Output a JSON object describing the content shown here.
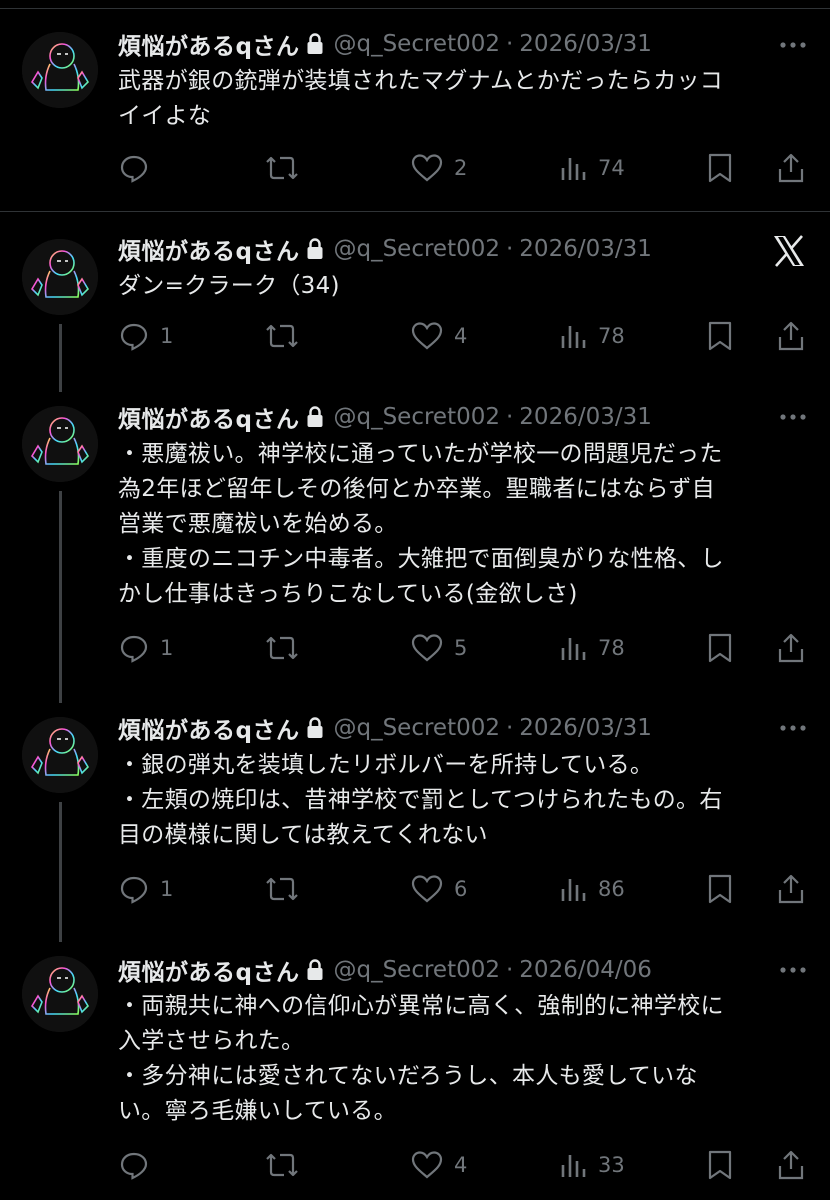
{
  "author": {
    "display_name": "煩悩があるqさん",
    "handle": "@q_Secret002"
  },
  "tweets": [
    {
      "date": "2026/03/31",
      "lines": [
        "武器が銀の銃弾が装填されたマグナムとかだったらカッコ",
        "イイよな"
      ],
      "replies": "",
      "likes": "2",
      "views": "74"
    },
    {
      "date": "2026/03/31",
      "lines": [
        "ダン=クラーク（34)"
      ],
      "replies": "1",
      "likes": "4",
      "views": "78"
    },
    {
      "date": "2026/03/31",
      "lines": [
        "・悪魔祓い。神学校に通っていたが学校一の問題児だった",
        "為2年ほど留年しその後何とか卒業。聖職者にはならず自",
        "営業で悪魔祓いを始める。",
        "・重度のニコチン中毒者。大雑把で面倒臭がりな性格、し",
        "かし仕事はきっちりこなしている(金欲しさ)"
      ],
      "replies": "1",
      "likes": "5",
      "views": "78"
    },
    {
      "date": "2026/03/31",
      "lines": [
        "・銀の弾丸を装填したリボルバーを所持している。",
        "・左頬の焼印は、昔神学校で罰としてつけられたもの。右",
        "目の模様に関しては教えてくれない"
      ],
      "replies": "1",
      "likes": "6",
      "views": "86"
    },
    {
      "date": "2026/04/06",
      "lines": [
        "・両親共に神への信仰心が異常に高く、強制的に神学校に",
        "入学させられた。",
        "・多分神には愛されてないだろうし、本人も愛していな",
        "い。寧ろ毛嫌いしている。"
      ],
      "replies": "",
      "likes": "4",
      "views": "33"
    }
  ],
  "icons": {
    "reply": "reply-icon",
    "retweet": "retweet-icon",
    "like": "like-icon",
    "views": "views-icon",
    "bookmark": "bookmark-icon",
    "share": "share-icon",
    "lock": "lock-icon",
    "more": "more-icon",
    "x_logo": "x-logo-icon"
  },
  "colors": {
    "background": "#000000",
    "text": "#e7e9ea",
    "muted": "#71767b",
    "divider": "#2f3336"
  }
}
